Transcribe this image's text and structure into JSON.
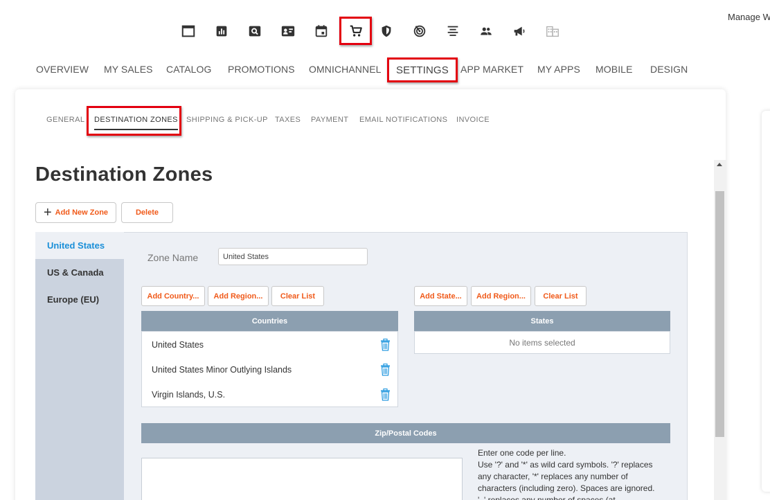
{
  "header": {
    "manage_text": "Manage We"
  },
  "icons": [
    "dashboard-window-icon",
    "sales-chart-icon",
    "search-icon",
    "contact-card-icon",
    "calendar-icon",
    "shopping-cart-icon",
    "shield-icon",
    "radar-icon",
    "align-center-icon",
    "people-icon",
    "megaphone-icon",
    "buildings-icon"
  ],
  "main_nav": [
    "OVERVIEW",
    "MY SALES",
    "CATALOG",
    "PROMOTIONS",
    "OMNICHANNEL",
    "SETTINGS",
    "APP MARKET",
    "MY APPS",
    "MOBILE",
    "DESIGN"
  ],
  "sub_nav": [
    "GENERAL",
    "DESTINATION ZONES",
    "SHIPPING & PICK-UP",
    "TAXES",
    "PAYMENT",
    "EMAIL NOTIFICATIONS",
    "INVOICE"
  ],
  "page": {
    "title": "Destination Zones",
    "add_zone_label": "Add New Zone",
    "delete_label": "Delete"
  },
  "zones": [
    "United States",
    "US & Canada",
    "Europe (EU)"
  ],
  "zone_form": {
    "name_label": "Zone Name",
    "name_value": "United States"
  },
  "countries": {
    "buttons": [
      "Add Country...",
      "Add Region...",
      "Clear List"
    ],
    "header": "Countries",
    "items": [
      "United States",
      "United States Minor Outlying Islands",
      "Virgin Islands, U.S."
    ]
  },
  "states": {
    "buttons": [
      "Add State...",
      "Add Region...",
      "Clear List"
    ],
    "header": "States",
    "empty_text": "No items selected"
  },
  "zip": {
    "header": "Zip/Postal Codes",
    "help_line1": "Enter one code per line.",
    "help_line2": "Use '?' and '*' as wild card symbols. '?' replaces any character, '*' replaces any number of characters (including zero). Spaces are ignored. '_' replaces any number of spaces (at"
  },
  "colors": {
    "accent": "#f05a1a",
    "highlight": "#e3000f",
    "link": "#1a8fd8",
    "table_header": "#8c9fb0"
  }
}
